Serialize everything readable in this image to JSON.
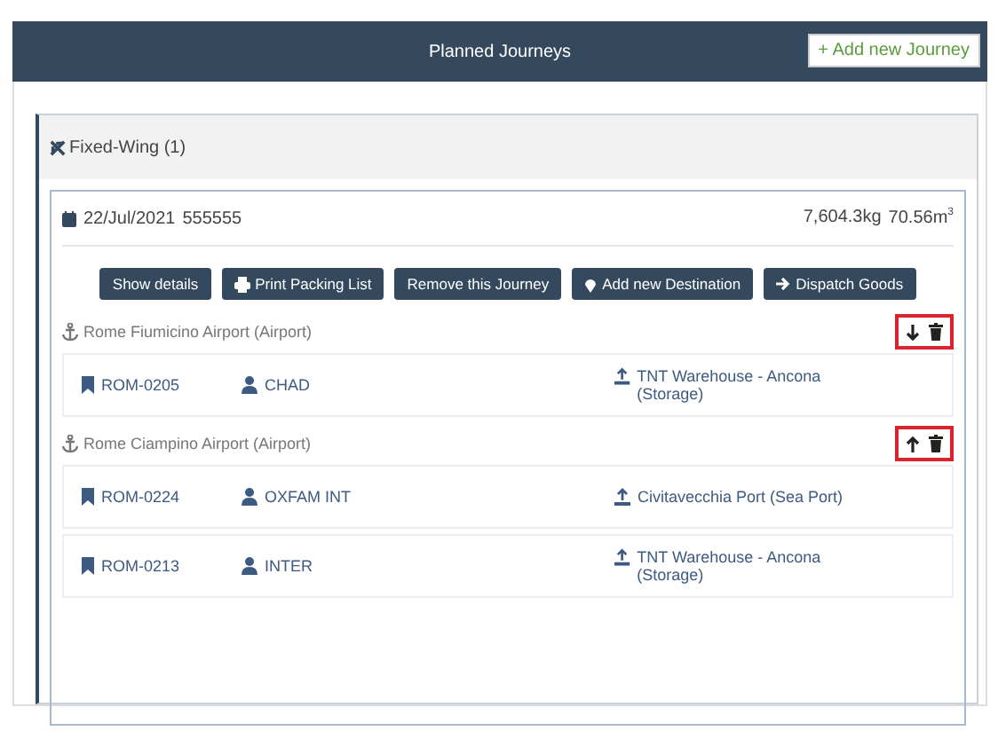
{
  "header": {
    "title": "Planned Journeys",
    "add_button": "+ Add new Journey"
  },
  "group": {
    "title": "Fixed-Wing (1)"
  },
  "journey": {
    "date": "22/Jul/2021",
    "code": "555555",
    "weight": "7,604.3kg",
    "volume": "70.56m$^{3}$",
    "buttons": [
      {
        "kind": "plain",
        "label": "Show details"
      },
      {
        "kind": "print",
        "label": "Print Packing List"
      },
      {
        "kind": "plain",
        "label": "Remove this Journey"
      },
      {
        "kind": "pin",
        "label": "Add new Destination"
      },
      {
        "kind": "arrow",
        "label": "Dispatch Goods"
      }
    ],
    "destinations": [
      {
        "name": "Rome Fiumicino Airport (Airport)",
        "kind": "move-down",
        "highlighted": true,
        "items": [
          {
            "ref": "ROM-0205",
            "org": "CHAD",
            "origin": "TNT Warehouse - Ancona (Storage)"
          }
        ]
      },
      {
        "name": "Rome Ciampino Airport (Airport)",
        "kind": "move-up",
        "highlighted": true,
        "items": [
          {
            "ref": "ROM-0224",
            "org": "OXFAM INT",
            "origin": "Civitavecchia Port (Sea Port)"
          },
          {
            "ref": "ROM-0213",
            "org": "INTER",
            "origin": "TNT Warehouse - Ancona (Storage)"
          }
        ]
      }
    ]
  }
}
